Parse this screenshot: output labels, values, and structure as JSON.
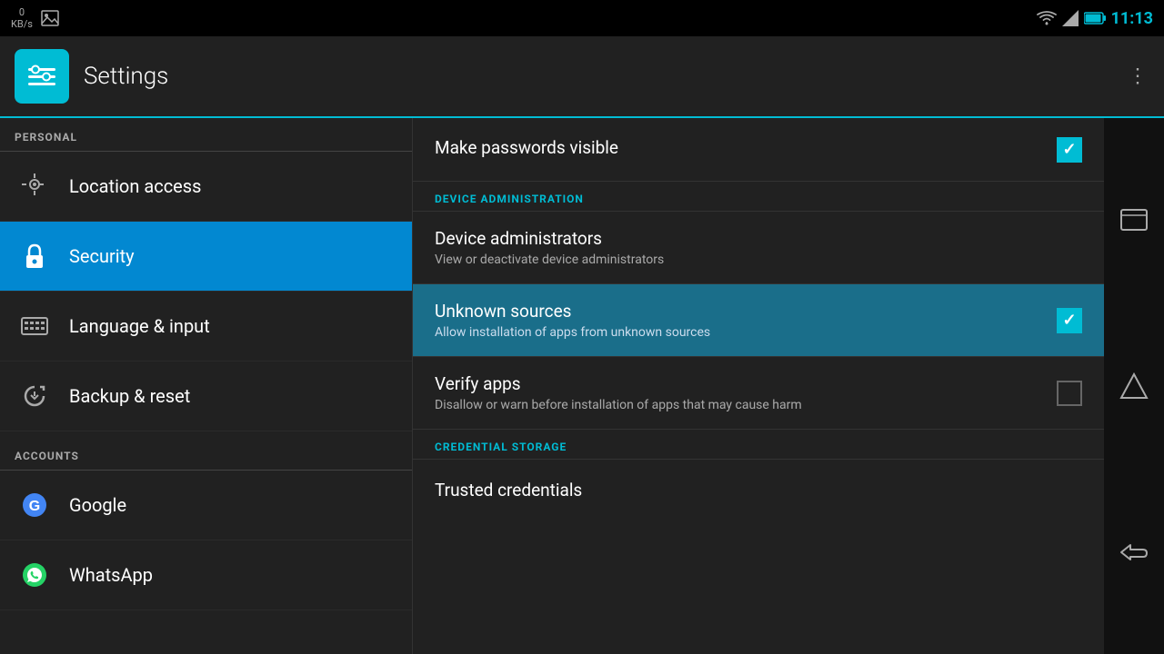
{
  "statusBar": {
    "kbps": "0\nKB/s",
    "time": "11:13"
  },
  "appBar": {
    "title": "Settings",
    "overflowLabel": "⋮"
  },
  "sidebar": {
    "sections": [
      {
        "header": "PERSONAL",
        "items": [
          {
            "id": "location-access",
            "label": "Location access",
            "icon": "location"
          },
          {
            "id": "security",
            "label": "Security",
            "icon": "lock",
            "active": true
          },
          {
            "id": "language-input",
            "label": "Language & input",
            "icon": "keyboard"
          },
          {
            "id": "backup-reset",
            "label": "Backup & reset",
            "icon": "backup"
          }
        ]
      },
      {
        "header": "ACCOUNTS",
        "items": [
          {
            "id": "google",
            "label": "Google",
            "icon": "google"
          },
          {
            "id": "whatsapp",
            "label": "WhatsApp",
            "icon": "whatsapp"
          }
        ]
      }
    ]
  },
  "content": {
    "sections": [
      {
        "type": "item",
        "title": "Make passwords visible",
        "subtitle": "",
        "checked": true,
        "highlighted": false
      },
      {
        "type": "section-label",
        "label": "DEVICE ADMINISTRATION"
      },
      {
        "type": "item",
        "title": "Device administrators",
        "subtitle": "View or deactivate device administrators",
        "checked": null,
        "highlighted": false
      },
      {
        "type": "item",
        "title": "Unknown sources",
        "subtitle": "Allow installation of apps from unknown sources",
        "checked": true,
        "highlighted": true
      },
      {
        "type": "item",
        "title": "Verify apps",
        "subtitle": "Disallow or warn before installation of apps that may cause harm",
        "checked": false,
        "highlighted": false
      },
      {
        "type": "section-label",
        "label": "CREDENTIAL STORAGE"
      },
      {
        "type": "item",
        "title": "Trusted credentials",
        "subtitle": "",
        "checked": null,
        "highlighted": false,
        "partial": true
      }
    ]
  },
  "navBar": {
    "recentApps": "recent-apps-icon",
    "home": "home-icon",
    "back": "back-icon"
  }
}
